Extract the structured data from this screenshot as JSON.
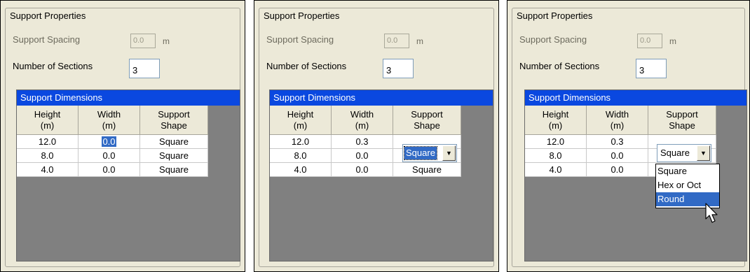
{
  "group_title": "Support Properties",
  "spacing": {
    "label": "Support Spacing",
    "value": "0.0",
    "unit": "m"
  },
  "sections": {
    "label": "Number of Sections",
    "value": "3"
  },
  "grid": {
    "title": "Support Dimensions",
    "headers": {
      "height": "Height\n(m)",
      "width": "Width\n(m)",
      "shape": "Support\nShape"
    }
  },
  "panels": [
    {
      "rows": [
        {
          "height": "12.0",
          "width": "0.0",
          "shape": "Square"
        },
        {
          "height": "8.0",
          "width": "0.0",
          "shape": "Square"
        },
        {
          "height": "4.0",
          "width": "0.0",
          "shape": "Square"
        }
      ]
    },
    {
      "rows": [
        {
          "height": "12.0",
          "width": "0.3",
          "shape": ""
        },
        {
          "height": "8.0",
          "width": "0.0",
          "shape": "Square"
        },
        {
          "height": "4.0",
          "width": "0.0",
          "shape": "Square"
        }
      ],
      "combo_value": "Square"
    },
    {
      "rows": [
        {
          "height": "12.0",
          "width": "0.3",
          "shape": ""
        },
        {
          "height": "8.0",
          "width": "0.0",
          "shape": ""
        },
        {
          "height": "4.0",
          "width": "0.0",
          "shape": ""
        }
      ],
      "combo_value": "Square",
      "dropdown_options": [
        "Square",
        "Hex or Oct",
        "Round"
      ],
      "dropdown_highlighted": "Round"
    }
  ],
  "colors": {
    "grid_title_bg": "#0a48e0",
    "selection": "#316ac5",
    "grid_bg": "#808080"
  },
  "icons": {
    "dropdown": "chevron-down-icon",
    "cursor": "mouse-pointer-icon"
  }
}
